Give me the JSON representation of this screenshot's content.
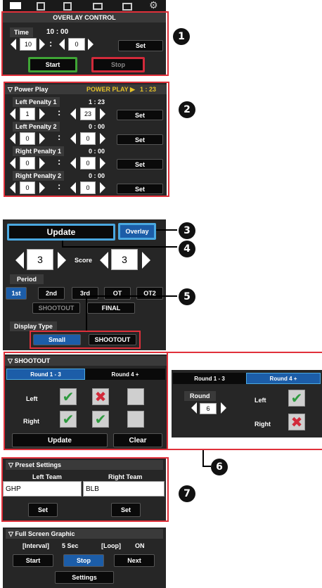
{
  "toolbar": {
    "icons": [
      "monitor-icon",
      "edit-icon",
      "list-edit-icon",
      "window-icon",
      "camera-settings-icon",
      "gear-icon"
    ]
  },
  "overlay": {
    "title": "OVERLAY CONTROL",
    "time_label": "Time",
    "time_value": "10 : 00",
    "min": "10",
    "sec": "0",
    "set": "Set",
    "start": "Start",
    "stop": "Stop"
  },
  "powerplay": {
    "header": "▽ Power Play",
    "status": "POWER PLAY ▶",
    "status_time": "1 : 23",
    "rows": [
      {
        "label": "Left Penalty 1",
        "time": "1 : 23",
        "min": "1",
        "sec": "23",
        "set": "Set"
      },
      {
        "label": "Left Penalty 2",
        "time": "0 : 00",
        "min": "0",
        "sec": "0",
        "set": "Set"
      },
      {
        "label": "Right Penalty 1",
        "time": "0 : 00",
        "min": "0",
        "sec": "0",
        "set": "Set"
      },
      {
        "label": "Right Penalty 2",
        "time": "0 : 00",
        "min": "0",
        "sec": "0",
        "set": "Set"
      }
    ]
  },
  "score": {
    "update": "Update",
    "overlay": "Overlay",
    "left": "3",
    "label": "Score",
    "right": "3",
    "period_label": "Period",
    "periods": [
      "1st",
      "2nd",
      "3rd",
      "OT",
      "OT2"
    ],
    "shootout": "SHOOTOUT",
    "final": "FINAL",
    "display_type_label": "Display Type",
    "small": "Small",
    "display_shootout": "SHOOTOUT"
  },
  "shootout": {
    "header": "▽ SHOOTOUT",
    "tab1": "Round 1 - 3",
    "tab2": "Round 4 +",
    "left": "Left",
    "right": "Right",
    "update": "Update",
    "clear": "Clear",
    "check": "✔",
    "cross": "✖"
  },
  "shootout_alt": {
    "tab1": "Round 1 - 3",
    "tab2": "Round 4 +",
    "round_label": "Round",
    "round_value": "6",
    "left": "Left",
    "right": "Right"
  },
  "preset": {
    "header": "▽ Preset Settings",
    "left_team_label": "Left Team",
    "right_team_label": "Right Team",
    "left_team": "GHP",
    "right_team": "BLB",
    "set": "Set"
  },
  "fullscreen": {
    "header": "▽ Full Screen Graphic",
    "interval_label": "[Interval]",
    "interval_value": "5 Sec",
    "loop_label": "[Loop]",
    "loop_value": "ON",
    "start": "Start",
    "stop": "Stop",
    "next": "Next",
    "settings": "Settings"
  },
  "callouts": [
    "1",
    "2",
    "3",
    "4",
    "5",
    "6",
    "7"
  ],
  "colors": {
    "accent_blue": "#1c5da8",
    "frame_red": "#e0303a",
    "start_green": "#3fa535",
    "stop_red": "#d22a3a",
    "highlight_blue": "#4aa8e0"
  }
}
